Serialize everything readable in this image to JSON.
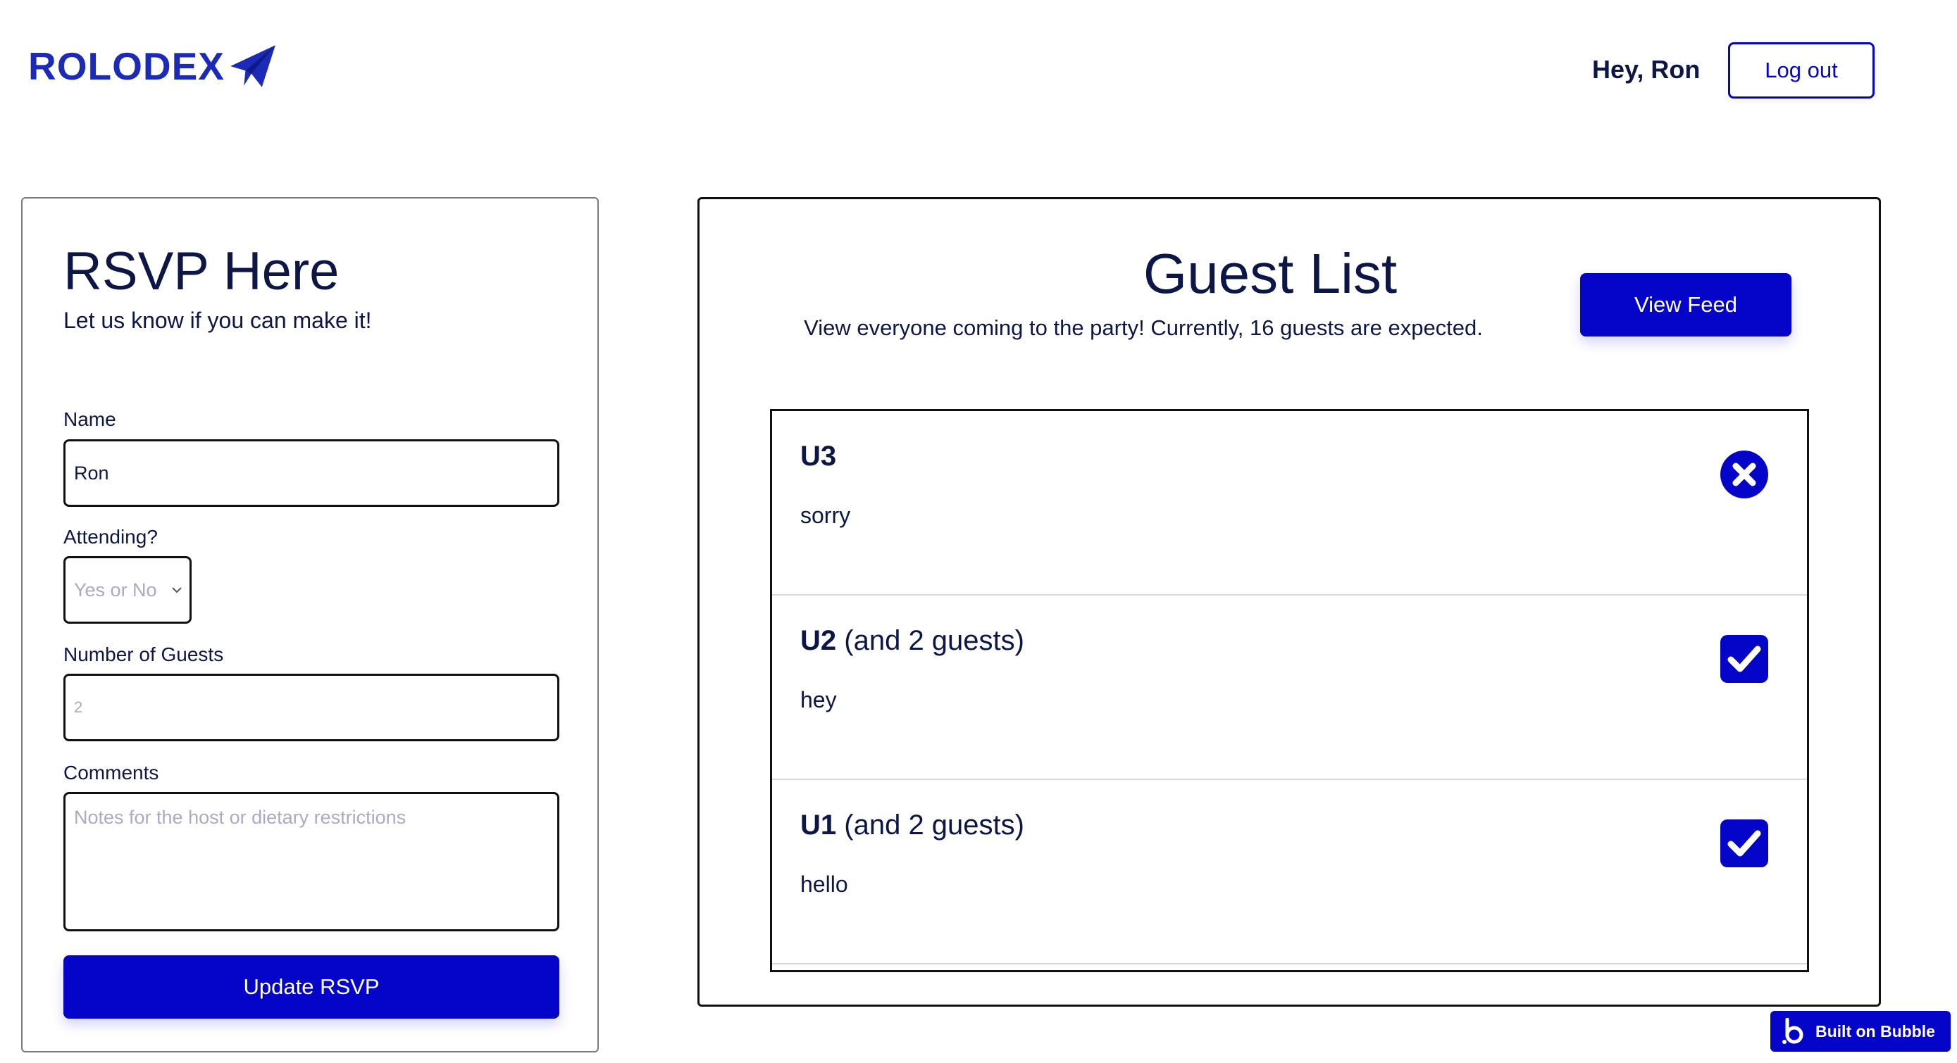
{
  "header": {
    "logo_text": "ROLODEX",
    "greeting": "Hey, Ron",
    "logout_label": "Log out"
  },
  "rsvp": {
    "title": "RSVP Here",
    "subtitle": "Let us know if you can make it!",
    "name_label": "Name",
    "name_value": "Ron",
    "attending_label": "Attending?",
    "attending_placeholder": "Yes or No",
    "guests_label": "Number of Guests",
    "guests_placeholder": "2",
    "comments_label": "Comments",
    "comments_placeholder": "Notes for the host or dietary restrictions",
    "submit_label": "Update RSVP"
  },
  "guest_list": {
    "title": "Guest List",
    "subtitle": "View everyone coming to the party! Currently, 16 guests are expected.",
    "view_feed_label": "View Feed",
    "entries": [
      {
        "name": "U3",
        "extra": "",
        "comment": "sorry",
        "status": "declined",
        "status_icon": "x-circle-icon"
      },
      {
        "name": "U2",
        "extra": "(and 2 guests)",
        "comment": "hey",
        "status": "attending",
        "status_icon": "checkbox-checked-icon"
      },
      {
        "name": "U1",
        "extra": "(and 2 guests)",
        "comment": "hello",
        "status": "attending",
        "status_icon": "checkbox-checked-icon"
      }
    ]
  },
  "badge": {
    "label": "Built on Bubble"
  },
  "colors": {
    "brand": "#1b2bb8",
    "primary": "#0505c9",
    "text": "#0d1747"
  }
}
